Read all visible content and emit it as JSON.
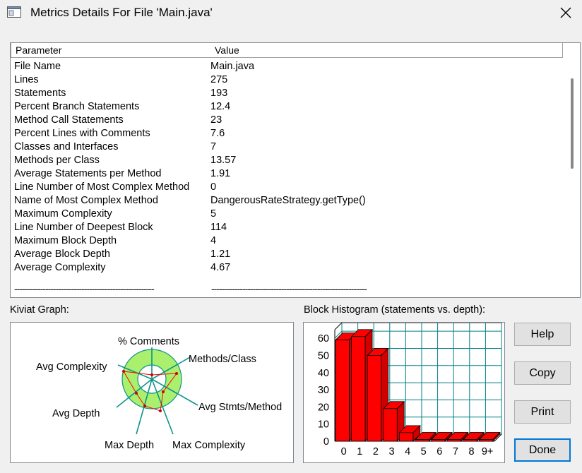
{
  "window": {
    "title": "Metrics Details For File 'Main.java'"
  },
  "table": {
    "columns": [
      "Parameter",
      "Value"
    ],
    "rows": [
      {
        "param": "File Name",
        "value": "Main.java"
      },
      {
        "param": "Lines",
        "value": "275"
      },
      {
        "param": "Statements",
        "value": "193"
      },
      {
        "param": "Percent Branch Statements",
        "value": "12.4"
      },
      {
        "param": "Method Call Statements",
        "value": "23"
      },
      {
        "param": "Percent Lines with Comments",
        "value": "7.6"
      },
      {
        "param": "Classes and Interfaces",
        "value": "7"
      },
      {
        "param": "Methods per Class",
        "value": "13.57"
      },
      {
        "param": "Average Statements per Method",
        "value": "1.91"
      },
      {
        "param": "Line Number of Most Complex Method",
        "value": "0"
      },
      {
        "param": "Name of Most Complex Method",
        "value": "DangerousRateStrategy.getType()"
      },
      {
        "param": "Maximum Complexity",
        "value": "5"
      },
      {
        "param": "Line Number of Deepest Block",
        "value": "114"
      },
      {
        "param": "Maximum Block Depth",
        "value": "4"
      },
      {
        "param": "Average Block Depth",
        "value": "1.21"
      },
      {
        "param": "Average Complexity",
        "value": "4.67"
      }
    ],
    "separator_param": "------------------------------------------------------",
    "separator_value": "------------------------------------------------------------"
  },
  "kiviat": {
    "label": "Kiviat Graph:",
    "axes": [
      "% Comments",
      "Methods/Class",
      "Avg Stmts/Method",
      "Max Complexity",
      "Max Depth",
      "Avg Depth",
      "Avg Complexity"
    ]
  },
  "histogram": {
    "label": "Block Histogram (statements vs. depth):"
  },
  "buttons": {
    "help": "Help",
    "copy": "Copy",
    "print": "Print",
    "done": "Done"
  },
  "colors": {
    "bar": "#ff0000",
    "grid": "#008080",
    "ring": "#aaf06e",
    "focus": "#0078d7"
  },
  "chart_data": {
    "type": "bar",
    "categories": [
      "0",
      "1",
      "2",
      "3",
      "4",
      "5",
      "6",
      "7",
      "8",
      "9+"
    ],
    "values": [
      59,
      61,
      50,
      19,
      5,
      1,
      1,
      1,
      1,
      1
    ],
    "ylim": [
      0,
      65
    ],
    "yticks": [
      0,
      10,
      20,
      30,
      40,
      50,
      60
    ],
    "grid": true
  }
}
